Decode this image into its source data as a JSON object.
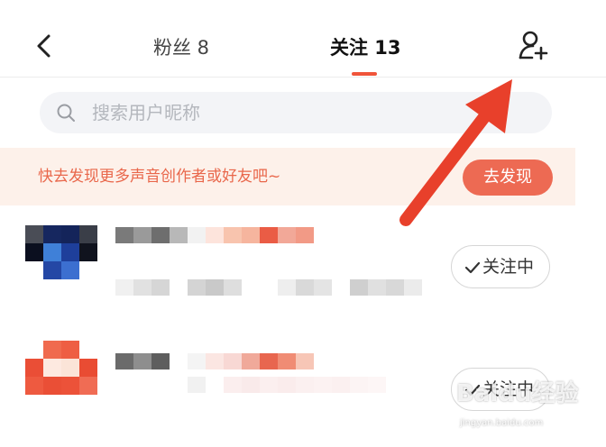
{
  "header": {
    "back_icon": "chevron-left-icon",
    "tabs": [
      {
        "label": "粉丝 8",
        "active": false
      },
      {
        "label": "关注 13",
        "active": true
      }
    ],
    "add_friend_icon": "add-user-icon",
    "accent_color": "#f0543a"
  },
  "search": {
    "icon": "search-icon",
    "placeholder": "搜索用户昵称",
    "value": ""
  },
  "banner": {
    "text": "快去发现更多声音创作者或好友吧~",
    "button_label": "去发现",
    "background_color": "#fdf1ea",
    "button_color": "#ed6a53"
  },
  "users": [
    {
      "name": "",
      "description": "",
      "avatar": "pixelated-avatar",
      "follow_label": "关注中",
      "check_icon": "check-icon"
    },
    {
      "name": "",
      "description": "",
      "avatar": "pixelated-avatar",
      "follow_label": "关注中",
      "check_icon": "check-icon"
    }
  ],
  "annotation": {
    "icon": "red-arrow-icon",
    "color": "#e8402b"
  },
  "watermark": {
    "brand": "Baidu经验",
    "url": "jingyan.baidu.com"
  }
}
